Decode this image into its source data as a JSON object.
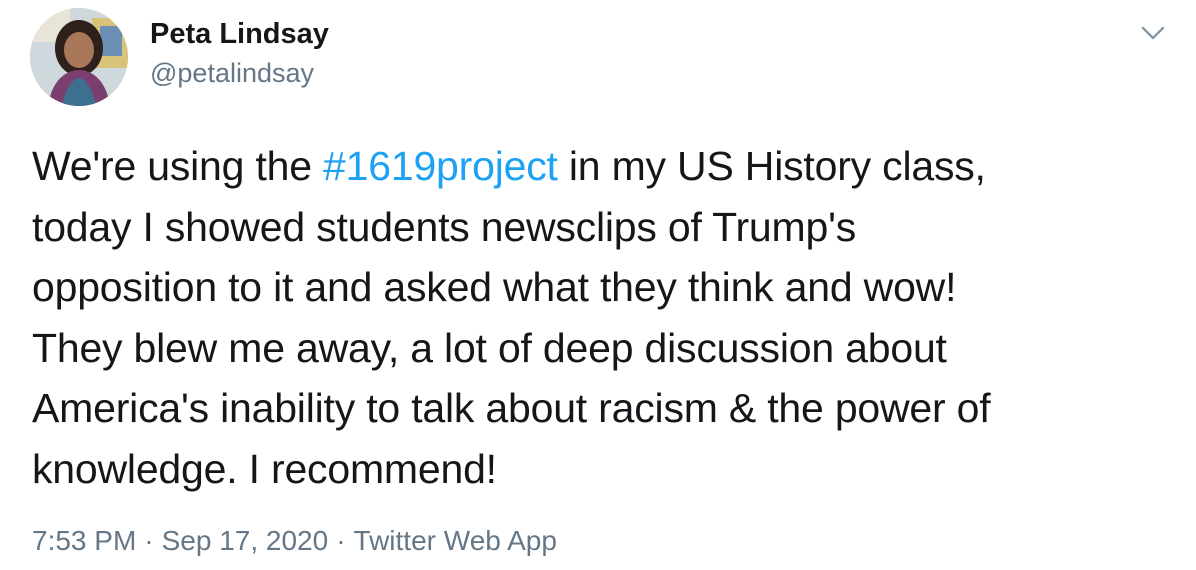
{
  "author": {
    "display_name": "Peta Lindsay",
    "handle": "@petalindsay",
    "avatar_icon": "profile-photo"
  },
  "menu": {
    "icon": "chevron-down-icon"
  },
  "tweet": {
    "lines": [
      {
        "before": "We're using the ",
        "hashtag": "#1619project",
        "after": " in my US History class,"
      },
      {
        "text": "today I showed students newsclips of Trump's"
      },
      {
        "text": "opposition to it and asked what they think and wow!"
      },
      {
        "text": "They blew me away, a lot of deep discussion about"
      },
      {
        "text": "America's inability to talk about racism & the power of"
      },
      {
        "text": "knowledge. I recommend!"
      }
    ]
  },
  "meta": {
    "time": "7:53 PM",
    "separator": "·",
    "date": "Sep 17, 2020",
    "source": "Twitter Web App"
  },
  "colors": {
    "text": "#14171a",
    "secondary": "#657786",
    "link": "#1da1f2"
  }
}
